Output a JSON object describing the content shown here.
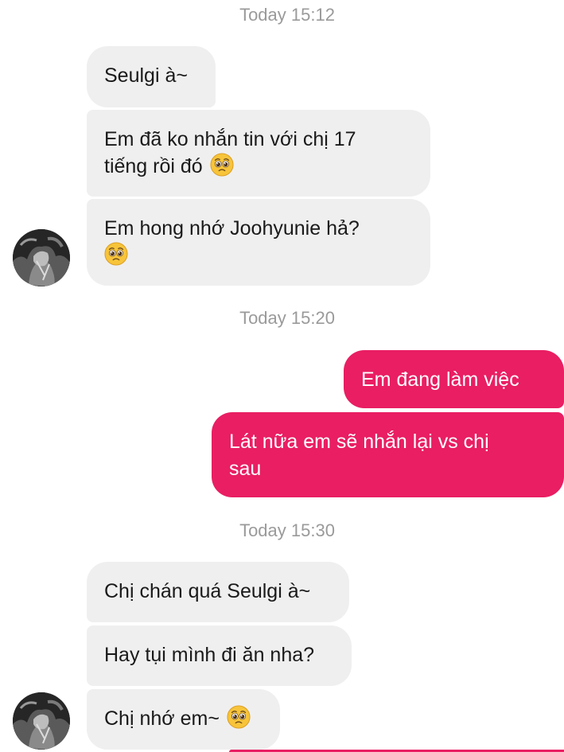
{
  "timestamps": [
    "Today 15:12",
    "Today 15:20",
    "Today 15:30"
  ],
  "messages": {
    "m1": "Seulgi à~",
    "m2_line1": "Em đã ko nhắn tin với chị 17",
    "m2_line2": "tiếng rồi đó",
    "m3_line1": "Em hong nhớ Joohyunie hả?",
    "m4": "Em đang làm việc",
    "m5_line1": "Lát nữa em sẽ nhắn lại vs chị",
    "m5_line2": "sau",
    "m6": "Chị chán quá Seulgi à~",
    "m7": "Hay tụi mình đi ăn nha?",
    "m8": "Chị nhớ em~"
  },
  "emoji": "pleading-face",
  "colors": {
    "incoming_bubble": "#efefef",
    "outgoing_bubble": "#e91e63",
    "timestamp": "#9a9a9a"
  }
}
